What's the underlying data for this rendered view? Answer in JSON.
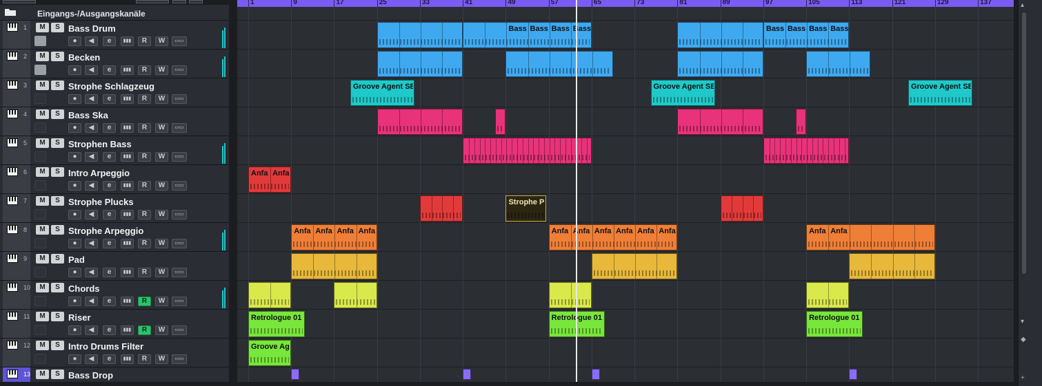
{
  "folder": {
    "title": "Eingangs-/Ausgangskanäle"
  },
  "buttons": {
    "mute": "M",
    "solo": "S",
    "edit": "e",
    "read": "R",
    "write": "W"
  },
  "colors": {
    "blue": "#3fa9f0",
    "cyan": "#1fc9c9",
    "pink": "#e8327a",
    "red": "#e23a3a",
    "orange": "#ef7f37",
    "yellow": "#e7b83a",
    "lime": "#d9e84a",
    "green": "#78e63a",
    "purple": "#8b6cf6",
    "olive": "#2b2611"
  },
  "ruler": {
    "labels": [
      "1",
      "9",
      "17",
      "25",
      "33",
      "41",
      "49",
      "57",
      "65",
      "73",
      "81",
      "89",
      "97",
      "105",
      "113",
      "121",
      "129",
      "137"
    ]
  },
  "tracks": [
    {
      "num": "1",
      "name": "Bass Drum",
      "sub": "bass-drum-icon",
      "meter": true
    },
    {
      "num": "2",
      "name": "Becken",
      "sub": "cymbal-icon",
      "meter": true
    },
    {
      "num": "3",
      "name": "Strophe Schlagzeug",
      "sub": "",
      "meter": false
    },
    {
      "num": "4",
      "name": "Bass Ska",
      "sub": "",
      "meter": false
    },
    {
      "num": "5",
      "name": "Strophen Bass",
      "sub": "",
      "meter": true
    },
    {
      "num": "6",
      "name": "Intro Arpeggio",
      "sub": "",
      "meter": false
    },
    {
      "num": "7",
      "name": "Strophe Plucks",
      "sub": "",
      "meter": false
    },
    {
      "num": "8",
      "name": "Strophe Arpeggio",
      "sub": "",
      "meter": true
    },
    {
      "num": "9",
      "name": "Pad",
      "sub": "",
      "meter": false
    },
    {
      "num": "10",
      "name": "Chords",
      "sub": "",
      "meter": true,
      "readActive": true
    },
    {
      "num": "11",
      "name": "Riser",
      "sub": "",
      "meter": false,
      "readActive": true
    },
    {
      "num": "12",
      "name": "Intro Drums Filter",
      "sub": "",
      "meter": false
    },
    {
      "num": "13",
      "name": "Bass Drop",
      "sub": "",
      "meter": false,
      "selected": true
    }
  ],
  "clips": [
    {
      "lane": 0,
      "startBar": 25,
      "bars": 16,
      "color": "blue",
      "divs": 4,
      "names": []
    },
    {
      "lane": 0,
      "startBar": 41,
      "bars": 24,
      "color": "blue",
      "divs": 6,
      "names": [
        "Bass",
        "Bass",
        "Bass",
        "Bass",
        "Bass",
        "Bass"
      ],
      "nameOffset": 2
    },
    {
      "lane": 0,
      "startBar": 81,
      "bars": 16,
      "color": "blue",
      "divs": 4,
      "names": []
    },
    {
      "lane": 0,
      "startBar": 97,
      "bars": 16,
      "color": "blue",
      "divs": 4,
      "names": [
        "Bass",
        "Bass",
        "Bass",
        "Bass"
      ]
    },
    {
      "lane": 1,
      "startBar": 25,
      "bars": 16,
      "color": "blue",
      "divs": 4,
      "names": []
    },
    {
      "lane": 1,
      "startBar": 49,
      "bars": 20,
      "color": "blue",
      "divs": 5,
      "names": []
    },
    {
      "lane": 1,
      "startBar": 81,
      "bars": 16,
      "color": "blue",
      "divs": 4,
      "names": []
    },
    {
      "lane": 1,
      "startBar": 105,
      "bars": 12,
      "color": "blue",
      "divs": 3,
      "names": []
    },
    {
      "lane": 2,
      "startBar": 20,
      "bars": 12,
      "color": "cyan",
      "divs": 1,
      "names": [
        "Groove Agent SE"
      ]
    },
    {
      "lane": 2,
      "startBar": 76,
      "bars": 12,
      "color": "cyan",
      "divs": 1,
      "names": [
        "Groove Agent SE"
      ]
    },
    {
      "lane": 2,
      "startBar": 124,
      "bars": 12,
      "color": "cyan",
      "divs": 1,
      "names": [
        "Groove Agent SE"
      ]
    },
    {
      "lane": 3,
      "startBar": 25,
      "bars": 16,
      "color": "pink",
      "divs": 4,
      "names": []
    },
    {
      "lane": 3,
      "startBar": 47,
      "bars": 2,
      "color": "pink",
      "divs": 1,
      "names": []
    },
    {
      "lane": 3,
      "startBar": 81,
      "bars": 16,
      "color": "pink",
      "divs": 4,
      "names": []
    },
    {
      "lane": 3,
      "startBar": 103,
      "bars": 2,
      "color": "pink",
      "divs": 1,
      "names": []
    },
    {
      "lane": 4,
      "startBar": 41,
      "bars": 24,
      "color": "pink",
      "divs": 24,
      "names": []
    },
    {
      "lane": 4,
      "startBar": 97,
      "bars": 16,
      "color": "pink",
      "divs": 16,
      "names": []
    },
    {
      "lane": 5,
      "startBar": 1,
      "bars": 8,
      "color": "red",
      "divs": 2,
      "names": [
        "Anfa",
        "Anfa"
      ]
    },
    {
      "lane": 6,
      "startBar": 33,
      "bars": 8,
      "color": "red",
      "divs": 4,
      "names": []
    },
    {
      "lane": 6,
      "startBar": 49,
      "bars": 7.5,
      "color": "olive",
      "divs": 1,
      "names": [
        "Strophe Pl"
      ],
      "textColor": "#f0e3b0"
    },
    {
      "lane": 6,
      "startBar": 89,
      "bars": 8,
      "color": "red",
      "divs": 4,
      "names": []
    },
    {
      "lane": 7,
      "startBar": 9,
      "bars": 16,
      "color": "orange",
      "divs": 4,
      "names": [
        "Anfa",
        "Anfa",
        "Anfa",
        "Anfa"
      ]
    },
    {
      "lane": 7,
      "startBar": 57,
      "bars": 24,
      "color": "orange",
      "divs": 6,
      "names": [
        "Anfa",
        "Anfa",
        "Anfa",
        "Anfa",
        "Anfa",
        "Anfa"
      ]
    },
    {
      "lane": 7,
      "startBar": 105,
      "bars": 24,
      "color": "orange",
      "divs": 6,
      "names": [
        "Anfa",
        "Anfa"
      ]
    },
    {
      "lane": 8,
      "startBar": 9,
      "bars": 16,
      "color": "yellow",
      "divs": 4,
      "names": []
    },
    {
      "lane": 8,
      "startBar": 65,
      "bars": 16,
      "color": "yellow",
      "divs": 4,
      "names": []
    },
    {
      "lane": 8,
      "startBar": 113,
      "bars": 16,
      "color": "yellow",
      "divs": 4,
      "names": []
    },
    {
      "lane": 9,
      "startBar": 1,
      "bars": 8,
      "color": "lime",
      "divs": 2,
      "names": []
    },
    {
      "lane": 9,
      "startBar": 17,
      "bars": 8,
      "color": "lime",
      "divs": 2,
      "names": []
    },
    {
      "lane": 9,
      "startBar": 57,
      "bars": 8,
      "color": "lime",
      "divs": 2,
      "names": []
    },
    {
      "lane": 9,
      "startBar": 105,
      "bars": 8,
      "color": "lime",
      "divs": 2,
      "names": []
    },
    {
      "lane": 10,
      "startBar": 1,
      "bars": 10.5,
      "color": "green",
      "divs": 1,
      "names": [
        "Retrologue 01"
      ]
    },
    {
      "lane": 10,
      "startBar": 57,
      "bars": 10.5,
      "color": "green",
      "divs": 1,
      "names": [
        "Retrologue 01"
      ]
    },
    {
      "lane": 10,
      "startBar": 105,
      "bars": 10.5,
      "color": "green",
      "divs": 1,
      "names": [
        "Retrologue 01"
      ]
    },
    {
      "lane": 11,
      "startBar": 1,
      "bars": 8,
      "color": "green",
      "divs": 1,
      "names": [
        "Groove Agent SE"
      ]
    },
    {
      "lane": 12,
      "startBar": 9,
      "bars": 1.5,
      "color": "purple",
      "divs": 1,
      "names": [],
      "small": true
    },
    {
      "lane": 12,
      "startBar": 41,
      "bars": 1.5,
      "color": "purple",
      "divs": 1,
      "names": [],
      "small": true
    },
    {
      "lane": 12,
      "startBar": 65,
      "bars": 1.5,
      "color": "purple",
      "divs": 1,
      "names": [],
      "small": true
    },
    {
      "lane": 12,
      "startBar": 113,
      "bars": 1.5,
      "color": "purple",
      "divs": 1,
      "names": [],
      "small": true
    }
  ],
  "playhead": {
    "bar": 62
  }
}
